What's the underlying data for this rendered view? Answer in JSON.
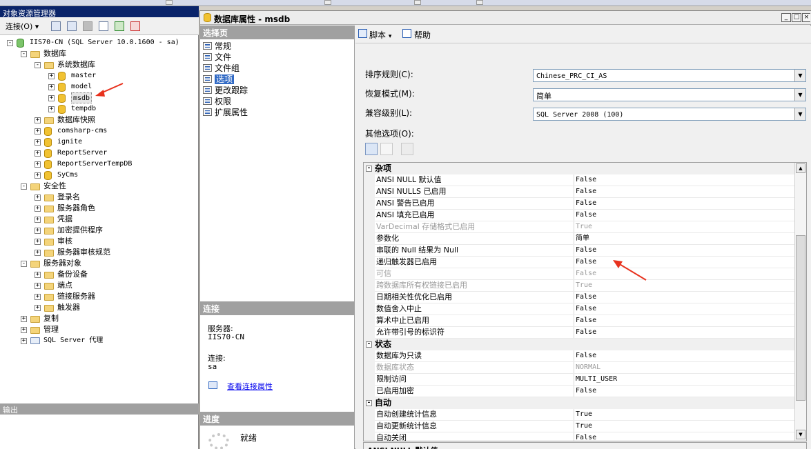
{
  "object_explorer": {
    "title": "对象资源管理器",
    "connect_label": "连接(O)",
    "connect_caret": "▾",
    "server": "IIS70-CN (SQL Server 10.0.1600 - sa)",
    "databases": "数据库",
    "system_databases": "系统数据库",
    "sys_dbs": [
      "master",
      "model",
      "msdb",
      "tempdb"
    ],
    "snapshots": "数据库快照",
    "user_dbs": [
      "comsharp-cms",
      "ignite",
      "ReportServer",
      "ReportServerTempDB",
      "SyCms"
    ],
    "security": "安全性",
    "security_items": [
      "登录名",
      "服务器角色",
      "凭据",
      "加密提供程序",
      "审核",
      "服务器审核规范"
    ],
    "server_objects": "服务器对象",
    "server_object_items": [
      "备份设备",
      "端点",
      "链接服务器",
      "触发器"
    ],
    "replication": "复制",
    "management": "管理",
    "agent": "SQL Server 代理"
  },
  "output_title": "输出",
  "dialog": {
    "title": "数据库属性 - msdb",
    "win_min": "_",
    "win_max": "□",
    "win_close": "×",
    "pages_header": "选择页",
    "pages": [
      "常规",
      "文件",
      "文件组",
      "选项",
      "更改跟踪",
      "权限",
      "扩展属性"
    ],
    "selected_page": "选项",
    "connection_header": "连接",
    "server_label": "服务器:",
    "server_value": "IIS70-CN",
    "conn_label": "连接:",
    "conn_value": "sa",
    "conn_link": "查看连接属性",
    "progress_header": "进度",
    "progress_status": "就绪",
    "script_label": "脚本",
    "script_caret": "▾",
    "help_label": "帮助",
    "collation_label": "排序规则(C):",
    "collation_value": "Chinese_PRC_CI_AS",
    "recovery_label": "恢复模式(M):",
    "recovery_value": "简单",
    "compat_label": "兼容级别(L):",
    "compat_value": "SQL Server 2008 (100)",
    "other_options_label": "其他选项(O):",
    "desc_text": "ANSI NULL 默认值"
  },
  "grid": {
    "cat_misc": "杂项",
    "misc": [
      {
        "name": "ANSI NULL 默认值",
        "value": "False",
        "disabled": false
      },
      {
        "name": "ANSI NULLS 已启用",
        "value": "False",
        "disabled": false
      },
      {
        "name": "ANSI 警告已启用",
        "value": "False",
        "disabled": false
      },
      {
        "name": "ANSI 填充已启用",
        "value": "False",
        "disabled": false
      },
      {
        "name": "VarDecimal 存储格式已启用",
        "value": "True",
        "disabled": true
      },
      {
        "name": "参数化",
        "value": "简单",
        "disabled": false
      },
      {
        "name": "串联的 Null 结果为 Null",
        "value": "False",
        "disabled": false
      },
      {
        "name": "递归触发器已启用",
        "value": "False",
        "disabled": false
      },
      {
        "name": "可信",
        "value": "False",
        "disabled": true
      },
      {
        "name": "跨数据库所有权链接已启用",
        "value": "True",
        "disabled": true
      },
      {
        "name": "日期相关性优化已启用",
        "value": "False",
        "disabled": false
      },
      {
        "name": "数值舍入中止",
        "value": "False",
        "disabled": false
      },
      {
        "name": "算术中止已启用",
        "value": "False",
        "disabled": false
      },
      {
        "name": "允许带引号的标识符",
        "value": "False",
        "disabled": false
      }
    ],
    "cat_state": "状态",
    "state": [
      {
        "name": "数据库为只读",
        "value": "False",
        "disabled": false
      },
      {
        "name": "数据库状态",
        "value": "NORMAL",
        "disabled": true
      },
      {
        "name": "限制访问",
        "value": "MULTI_USER",
        "disabled": false
      },
      {
        "name": "已启用加密",
        "value": "False",
        "disabled": false
      }
    ],
    "cat_auto": "自动",
    "auto": [
      {
        "name": "自动创建统计信息",
        "value": "True",
        "disabled": false
      },
      {
        "name": "自动更新统计信息",
        "value": "True",
        "disabled": false
      },
      {
        "name": "自动关闭",
        "value": "False",
        "disabled": false
      }
    ]
  },
  "colors": {
    "annotation_arrow": "#e8321e",
    "title_active": "#0a246a",
    "selection": "#316ac5"
  }
}
